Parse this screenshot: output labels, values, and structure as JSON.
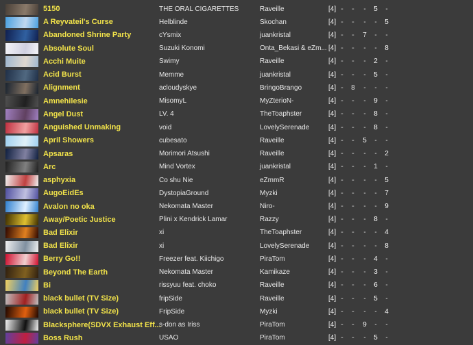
{
  "songs": [
    {
      "title": "5150",
      "artist": "THE ORAL CIGARETTES",
      "charter": "Raveille",
      "level": "[4]",
      "diffs": [
        "-",
        "-",
        "-",
        "5",
        "-"
      ],
      "thumb": [
        "#4a4038",
        "#8a7a6a"
      ]
    },
    {
      "title": "A Reyvateil's Curse",
      "artist": "Helblinde",
      "charter": "Skochan",
      "level": "[4]",
      "diffs": [
        "-",
        "-",
        "-",
        "-",
        "5"
      ],
      "thumb": [
        "#4aa0e0",
        "#c0d8f0"
      ]
    },
    {
      "title": "Abandoned Shrine Party",
      "artist": "cYsmix",
      "charter": "juankristal",
      "level": "[4]",
      "diffs": [
        "-",
        "-",
        "7",
        "-",
        "-"
      ],
      "thumb": [
        "#102050",
        "#3060a0"
      ]
    },
    {
      "title": "Absolute Soul",
      "artist": "Suzuki Konomi",
      "charter": "Onta_Bekasi & eZm...",
      "level": "[4]",
      "diffs": [
        "-",
        "-",
        "-",
        "-",
        "8"
      ],
      "thumb": [
        "#f4f4f8",
        "#d0d0e0"
      ]
    },
    {
      "title": "Acchi Muite",
      "artist": "Swimy",
      "charter": "Raveille",
      "level": "[4]",
      "diffs": [
        "-",
        "-",
        "-",
        "2",
        "-"
      ],
      "thumb": [
        "#a0b8d0",
        "#e0d8d0"
      ]
    },
    {
      "title": "Acid Burst",
      "artist": "Memme",
      "charter": "juankristal",
      "level": "[4]",
      "diffs": [
        "-",
        "-",
        "-",
        "5",
        "-"
      ],
      "thumb": [
        "#203048",
        "#506880"
      ]
    },
    {
      "title": "Alignment",
      "artist": "acloudyskye",
      "charter": "BringoBrango",
      "level": "[4]",
      "diffs": [
        "-",
        "8",
        "-",
        "-",
        "-"
      ],
      "thumb": [
        "#1a2430",
        "#807060"
      ]
    },
    {
      "title": "Amnehilesie",
      "artist": "MisomyL",
      "charter": "MyZterioN-",
      "level": "[4]",
      "diffs": [
        "-",
        "-",
        "-",
        "9",
        "-"
      ],
      "thumb": [
        "#505050",
        "#202020"
      ]
    },
    {
      "title": "Angel Dust",
      "artist": "LV. 4",
      "charter": "TheToaphster",
      "level": "[4]",
      "diffs": [
        "-",
        "-",
        "-",
        "8",
        "-"
      ],
      "thumb": [
        "#a080c0",
        "#604060"
      ]
    },
    {
      "title": "Anguished Unmaking",
      "artist": "void",
      "charter": "LovelySerenade",
      "level": "[4]",
      "diffs": [
        "-",
        "-",
        "-",
        "8",
        "-"
      ],
      "thumb": [
        "#c03040",
        "#f0a0a0"
      ]
    },
    {
      "title": "April Showers",
      "artist": "cubesato",
      "charter": "Raveille",
      "level": "[4]",
      "diffs": [
        "-",
        "-",
        "5",
        "-",
        "-"
      ],
      "thumb": [
        "#a0d0f0",
        "#e0f0f8"
      ]
    },
    {
      "title": "Apsaras",
      "artist": "Morimori Atsushi",
      "charter": "Raveille",
      "level": "[4]",
      "diffs": [
        "-",
        "-",
        "-",
        "-",
        "2"
      ],
      "thumb": [
        "#102040",
        "#8080a0"
      ]
    },
    {
      "title": "Arc",
      "artist": "Mind Vortex",
      "charter": "juankristal",
      "level": "[4]",
      "diffs": [
        "-",
        "-",
        "-",
        "1",
        "-"
      ],
      "thumb": [
        "#202020",
        "#808080"
      ]
    },
    {
      "title": "asphyxia",
      "artist": "Co shu Nie",
      "charter": "eZmmR",
      "level": "[4]",
      "diffs": [
        "-",
        "-",
        "-",
        "-",
        "5"
      ],
      "thumb": [
        "#f0f0f0",
        "#c04040"
      ]
    },
    {
      "title": "AugoEidEs",
      "artist": "DystopiaGround",
      "charter": "Myzki",
      "level": "[4]",
      "diffs": [
        "-",
        "-",
        "-",
        "-",
        "7"
      ],
      "thumb": [
        "#5050a0",
        "#c0c0e0"
      ]
    },
    {
      "title": "Avalon no oka",
      "artist": "Nekomata Master",
      "charter": "Niro-",
      "level": "[4]",
      "diffs": [
        "-",
        "-",
        "-",
        "-",
        "9"
      ],
      "thumb": [
        "#3080d0",
        "#e0f0ff"
      ]
    },
    {
      "title": "Away/Poetic Justice",
      "artist": "Plini x Kendrick Lamar",
      "charter": "Razzy",
      "level": "[4]",
      "diffs": [
        "-",
        "-",
        "-",
        "8",
        "-"
      ],
      "thumb": [
        "#403000",
        "#e0c030"
      ]
    },
    {
      "title": "Bad Elixir",
      "artist": "xi",
      "charter": "TheToaphster",
      "level": "[4]",
      "diffs": [
        "-",
        "-",
        "-",
        "-",
        "4"
      ],
      "thumb": [
        "#300800",
        "#e08020"
      ]
    },
    {
      "title": "Bad Elixir",
      "artist": "xi",
      "charter": "LovelySerenade",
      "level": "[4]",
      "diffs": [
        "-",
        "-",
        "-",
        "-",
        "8"
      ],
      "thumb": [
        "#f0f0f0",
        "#8090a0"
      ]
    },
    {
      "title": "Berry Go!!",
      "artist": "Freezer feat. Kiichigo",
      "charter": "PiraTom",
      "level": "[4]",
      "diffs": [
        "-",
        "-",
        "-",
        "4",
        "-"
      ],
      "thumb": [
        "#d01030",
        "#f0d0d0"
      ]
    },
    {
      "title": "Beyond The Earth",
      "artist": "Nekomata Master",
      "charter": "Kamikaze",
      "level": "[4]",
      "diffs": [
        "-",
        "-",
        "-",
        "3",
        "-"
      ],
      "thumb": [
        "#302010",
        "#806020"
      ]
    },
    {
      "title": "Bi",
      "artist": "rissyuu feat. choko",
      "charter": "Raveille",
      "level": "[4]",
      "diffs": [
        "-",
        "-",
        "-",
        "6",
        "-"
      ],
      "thumb": [
        "#f0d060",
        "#4080c0"
      ]
    },
    {
      "title": "black bullet (TV Size)",
      "artist": "fripSide",
      "charter": "Raveille",
      "level": "[4]",
      "diffs": [
        "-",
        "-",
        "-",
        "5",
        "-"
      ],
      "thumb": [
        "#c0c0c0",
        "#a02020"
      ]
    },
    {
      "title": "black bullet (TV Size)",
      "artist": "FripSide",
      "charter": "Myzki",
      "level": "[4]",
      "diffs": [
        "-",
        "-",
        "-",
        "-",
        "4"
      ],
      "thumb": [
        "#200800",
        "#e06010"
      ]
    },
    {
      "title": "Blacksphere(SDVX Exhaust Eff...",
      "artist": "s-don as Iriss",
      "charter": "PiraTom",
      "level": "[4]",
      "diffs": [
        "-",
        "-",
        "9",
        "-",
        "-"
      ],
      "thumb": [
        "#f0f0f0",
        "#101010"
      ]
    },
    {
      "title": "Boss Rush",
      "artist": "USAO",
      "charter": "PiraTom",
      "level": "[4]",
      "diffs": [
        "-",
        "-",
        "-",
        "5",
        "-"
      ],
      "thumb": [
        "#6040a0",
        "#c02040"
      ]
    }
  ]
}
